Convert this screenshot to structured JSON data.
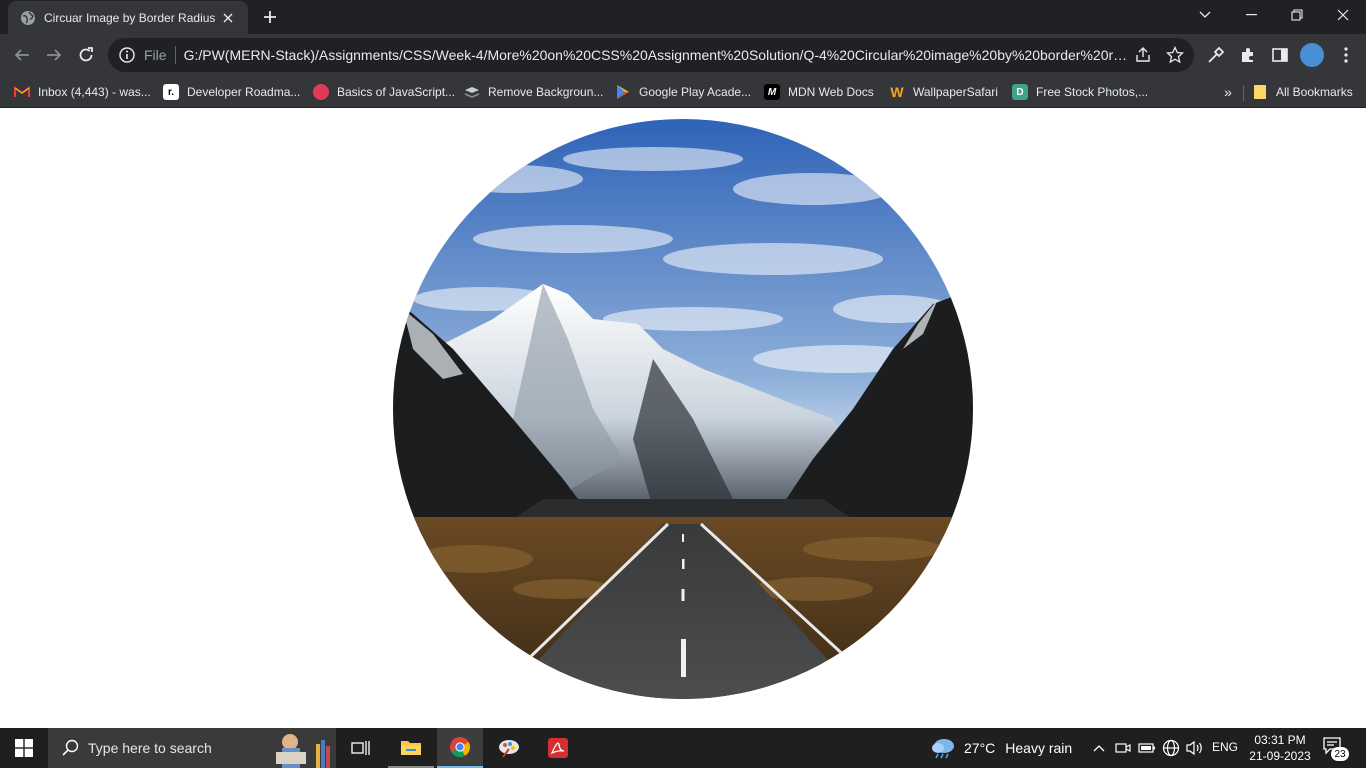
{
  "browser": {
    "tab": {
      "title": "Circuar Image by Border Radius"
    },
    "address": {
      "scheme_label": "File",
      "url": "G:/PW(MERN-Stack)/Assignments/CSS/Week-4/More%20on%20CSS%20Assignment%20Solution/Q-4%20Circular%20image%20by%20border%20radiu..."
    },
    "bookmarks": [
      {
        "label": "Inbox (4,443) - was...",
        "icon": "gmail-icon"
      },
      {
        "label": "Developer Roadma...",
        "icon": "roadmap-icon"
      },
      {
        "label": "Basics of JavaScript...",
        "icon": "js-basics-icon"
      },
      {
        "label": "Remove Backgroun...",
        "icon": "remove-bg-icon"
      },
      {
        "label": "Google Play Acade...",
        "icon": "google-play-icon"
      },
      {
        "label": "MDN Web Docs",
        "icon": "mdn-icon"
      },
      {
        "label": "WallpaperSafari",
        "icon": "wallpapersafari-icon"
      },
      {
        "label": "Free Stock Photos,...",
        "icon": "stock-photos-icon"
      }
    ],
    "all_bookmarks_label": "All Bookmarks",
    "more_chevron": "»"
  },
  "page": {
    "image": {
      "subject": "mountain-road-landscape"
    }
  },
  "taskbar": {
    "search_placeholder": "Type here to search",
    "weather": {
      "temp": "27°C",
      "condition": "Heavy rain"
    },
    "language": "ENG",
    "time": "03:31 PM",
    "date": "21-09-2023",
    "notifications": "23"
  },
  "colors": {
    "chrome_dark": "#202124",
    "chrome_toolbar": "#35363a",
    "taskbar": "#1f1f1f",
    "accent_blue": "#76b9ed"
  }
}
